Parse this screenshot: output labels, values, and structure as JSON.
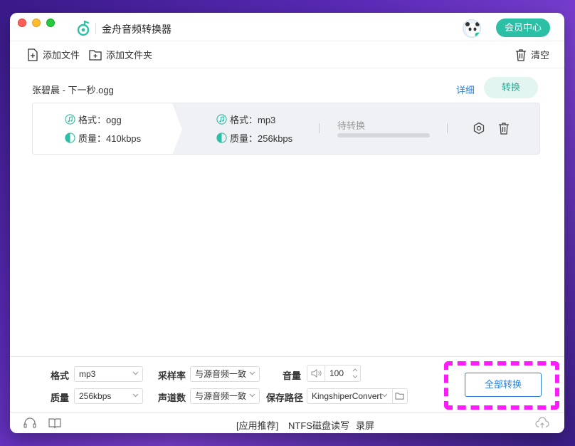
{
  "app": {
    "title": "金舟音频转换器",
    "vip_label": "会员中心",
    "accent": "#2bbfa6"
  },
  "toolbar": {
    "add_file": "添加文件",
    "add_folder": "添加文件夹",
    "clear": "清空"
  },
  "file": {
    "name": "张碧晨 - 下一秒.ogg",
    "detail_label": "详细",
    "convert_label": "转换",
    "source": {
      "format_label": "格式：ogg",
      "quality_label": "质量：410kbps"
    },
    "target": {
      "format_label": "格式：mp3",
      "quality_label": "质量：256kbps"
    },
    "status": "待转换",
    "progress": 0
  },
  "settings": {
    "format_label": "格式",
    "format_value": "mp3",
    "quality_label": "质量",
    "quality_value": "256kbps",
    "sample_rate_label": "采样率",
    "sample_rate_value": "与源音频一致",
    "channel_label": "声道数",
    "channel_value": "与源音频一致",
    "volume_label": "音量",
    "volume_value": "100",
    "path_label": "保存路径",
    "path_value": "KingshiperConvert",
    "convert_all": "全部转换"
  },
  "footer": {
    "recommend": "[应用推荐]",
    "ntfs": "NTFS磁盘读写",
    "record": "录屏"
  }
}
